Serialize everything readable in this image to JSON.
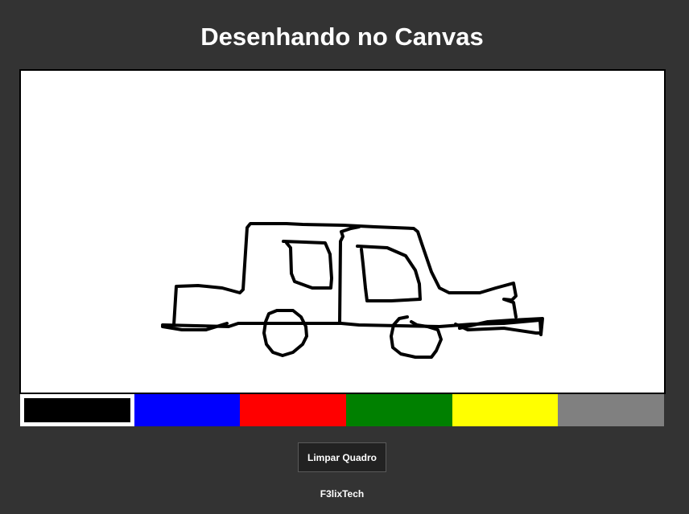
{
  "page": {
    "title": "Desenhando no Canvas",
    "footer": "F3lixTech"
  },
  "canvas": {
    "background": "#ffffff",
    "stroke_color": "#000000",
    "drawing_subject": "car sketch"
  },
  "palette": {
    "selected_index": 0,
    "colors": [
      {
        "name": "black",
        "hex": "#000000"
      },
      {
        "name": "blue",
        "hex": "#0000ff"
      },
      {
        "name": "red",
        "hex": "#ff0000"
      },
      {
        "name": "green",
        "hex": "#008000"
      },
      {
        "name": "yellow",
        "hex": "#ffff00"
      },
      {
        "name": "gray",
        "hex": "#808080"
      }
    ]
  },
  "controls": {
    "clear_label": "Limpar Quadro"
  }
}
